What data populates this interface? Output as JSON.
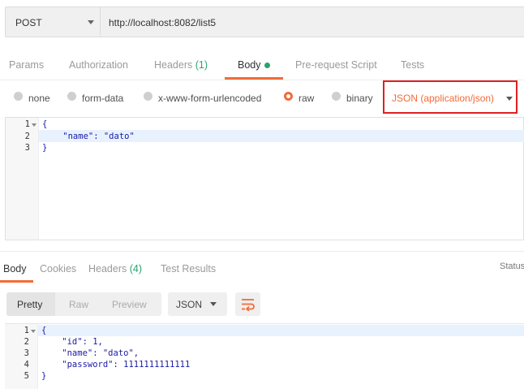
{
  "request": {
    "method": "POST",
    "url": "http://localhost:8082/list5"
  },
  "request_tabs": [
    {
      "label": "Params"
    },
    {
      "label": "Authorization"
    },
    {
      "label": "Headers",
      "count": "(1)"
    },
    {
      "label": "Body",
      "active": true
    },
    {
      "label": "Pre-request Script"
    },
    {
      "label": "Tests"
    }
  ],
  "body_types": [
    {
      "label": "none",
      "selected": false
    },
    {
      "label": "form-data",
      "selected": false
    },
    {
      "label": "x-www-form-urlencoded",
      "selected": false
    },
    {
      "label": "raw",
      "selected": true
    },
    {
      "label": "binary",
      "selected": false
    }
  ],
  "content_type": "JSON (application/json)",
  "request_body": {
    "line_numbers": [
      "1",
      "2",
      "3"
    ],
    "lines": [
      "{",
      "    \"name\": \"dato\"",
      "}"
    ]
  },
  "response_tabs": [
    {
      "label": "Body",
      "active": true
    },
    {
      "label": "Cookies"
    },
    {
      "label": "Headers",
      "count": "(4)"
    },
    {
      "label": "Test Results"
    }
  ],
  "status_label": "Status",
  "response_view": {
    "modes": [
      "Pretty",
      "Raw",
      "Preview"
    ],
    "active_mode": "Pretty",
    "format": "JSON"
  },
  "response_body": {
    "line_numbers": [
      "1",
      "2",
      "3",
      "4",
      "5"
    ],
    "lines": [
      "{",
      "    \"id\": 1,",
      "    \"name\": \"dato\",",
      "    \"password\": 1111111111111",
      "}"
    ]
  },
  "colors": {
    "accent": "#f26b3a",
    "count_green": "#2aa36c",
    "highlight_box": "#e02020"
  },
  "icons": [
    "chevron-down-icon",
    "fold-arrow-icon",
    "text-wrap-icon"
  ]
}
